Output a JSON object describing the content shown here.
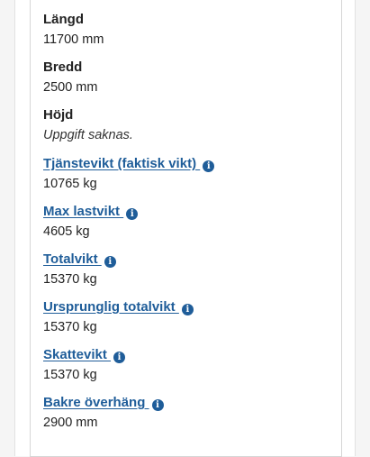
{
  "fields": [
    {
      "label": "Längd",
      "value": "11700 mm"
    },
    {
      "label": "Bredd",
      "value": "2500 mm"
    },
    {
      "label": "Höjd",
      "value": "Uppgift saknas."
    },
    {
      "label": "Tjänstevikt (faktisk vikt) ",
      "value": "10765 kg",
      "icon": "info-icon"
    },
    {
      "label": "Max lastvikt ",
      "value": "4605 kg",
      "icon": "info-icon"
    },
    {
      "label": "Totalvikt ",
      "value": "15370 kg",
      "icon": "info-icon"
    },
    {
      "label": "Ursprunglig totalvikt ",
      "value": "15370 kg",
      "icon": "info-icon"
    },
    {
      "label": "Skattevikt ",
      "value": "15370 kg",
      "icon": "info-icon"
    },
    {
      "label": "Bakre överhäng ",
      "value": "2900 mm",
      "icon": "info-icon"
    }
  ],
  "colors": {
    "link": "#1f5d99",
    "text": "#222222",
    "border": "#d6d6d6"
  }
}
